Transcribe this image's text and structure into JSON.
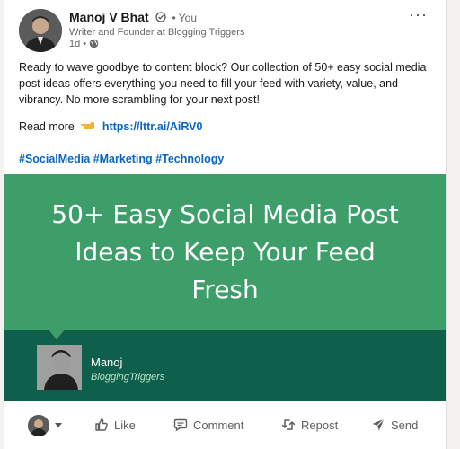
{
  "author": {
    "name": "Manoj V Bhat",
    "you_label": "• You",
    "headline": "Writer and Founder at Blogging Triggers",
    "time": "1d •"
  },
  "post": {
    "text": "Ready to wave goodbye to content block? Our collection of 50+ easy social media post ideas offers everything you need to fill your feed with variety, value, and vibrancy. No more scrambling for your next post!",
    "read_more_label": "Read more",
    "link": "https://lttr.ai/AiRV0",
    "hashtags": [
      "#SocialMedia",
      "#Marketing",
      "#Technology"
    ]
  },
  "banner": {
    "title_lines": [
      "50+ Easy Social Media Post",
      "Ideas to Keep Your Feed",
      "Fresh"
    ],
    "signature_name": "Manoj",
    "signature_brand": "BloggingTriggers",
    "colors": {
      "top": "#3d9e6a",
      "bottom": "#0e5f4c"
    }
  },
  "actions": {
    "like": "Like",
    "comment": "Comment",
    "repost": "Repost",
    "send": "Send"
  },
  "icons": {
    "more": "more-icon",
    "verified": "verified-icon",
    "globe": "globe-icon",
    "like": "thumbs-up-icon",
    "comment": "comment-icon",
    "repost": "repost-icon",
    "send": "send-icon"
  }
}
